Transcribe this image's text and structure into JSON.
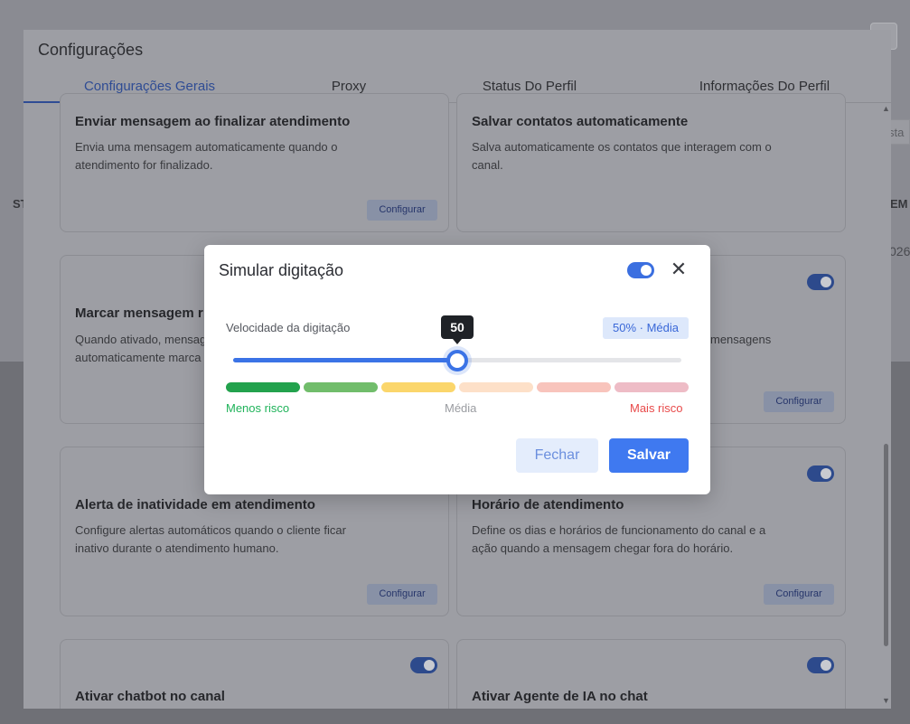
{
  "background": {
    "right_input_text": "sta",
    "right_header_text": "EM",
    "right_cell_text": "026",
    "left_header_text": "ST"
  },
  "outer_modal": {
    "title": "Configurações",
    "close_symbol": "✕",
    "tabs": [
      {
        "label": "Configurações Gerais",
        "active": true
      },
      {
        "label": "Proxy",
        "active": false
      },
      {
        "label": "Status Do Perfil",
        "active": false
      },
      {
        "label": "Informações Do Perfil",
        "active": false
      }
    ],
    "cards": [
      {
        "title": "Enviar mensagem ao finalizar atendimento",
        "desc": "Envia uma mensagem automaticamente quando o atendimento for finalizado.",
        "button": "Configurar"
      },
      {
        "title": "Salvar contatos automaticamente",
        "desc": "Salva automaticamente os contatos que interagem com o canal."
      },
      {
        "title": "Marcar mensagem r",
        "desc": "Quando ativado, mensag automaticamente marca"
      },
      {
        "desc": "mensagens",
        "button": "Configurar",
        "toggle_on": true
      },
      {
        "title": "Alerta de inatividade em atendimento",
        "desc": "Configure alertas automáticos quando o cliente ficar inativo durante o atendimento humano.",
        "button": "Configurar"
      },
      {
        "title": "Horário de atendimento",
        "desc": "Define os dias e horários de funcionamento do canal e a ação quando a mensagem chegar fora do horário.",
        "button": "Configurar",
        "toggle_on": true
      },
      {
        "title": "Ativar chatbot no canal",
        "toggle_on": true
      },
      {
        "title": "Ativar Agente de IA no chat",
        "toggle_on": true
      }
    ]
  },
  "dialog": {
    "title": "Simular digitação",
    "enabled": true,
    "close_symbol": "✕",
    "speed_label": "Velocidade da digitação",
    "speed_badge": "50% · Média",
    "slider_value": "50",
    "slider_fraction": 0.5,
    "risk_segments": [
      "#23a24d",
      "#71bd6b",
      "#fbd66b",
      "#fde0c8",
      "#f8c4bc",
      "#eebcc6"
    ],
    "risk_labels": {
      "less": "Menos risco",
      "mid": "Média",
      "more": "Mais risco"
    },
    "risk_colors": {
      "less": "#1fb35a",
      "mid": "#9a9ca1",
      "more": "#e84a4a"
    },
    "close_button": "Fechar",
    "save_button": "Salvar"
  }
}
